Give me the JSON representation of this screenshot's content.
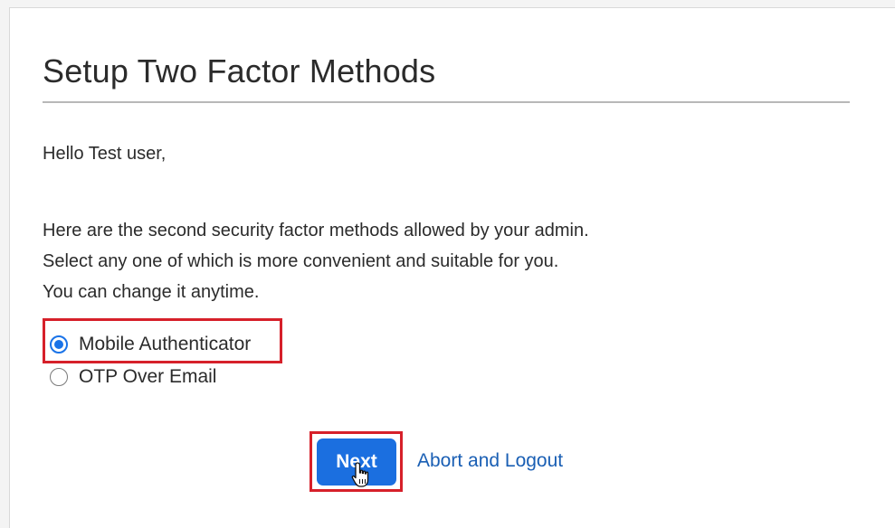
{
  "page": {
    "title": "Setup Two Factor Methods",
    "greeting": "Hello Test user,",
    "description_lines": [
      "Here are the second security factor methods allowed by your admin.",
      "Select any one of which is more convenient and suitable for you.",
      "You can change it anytime."
    ]
  },
  "methods": [
    {
      "label": "Mobile Authenticator",
      "selected": true
    },
    {
      "label": "OTP Over Email",
      "selected": false
    }
  ],
  "actions": {
    "next_label": "Next",
    "abort_label": "Abort and Logout"
  },
  "colors": {
    "accent": "#1b6fe0",
    "link": "#1a5fb4",
    "highlight": "#d6202a"
  },
  "icons": {
    "cursor": "hand-pointer-icon"
  }
}
